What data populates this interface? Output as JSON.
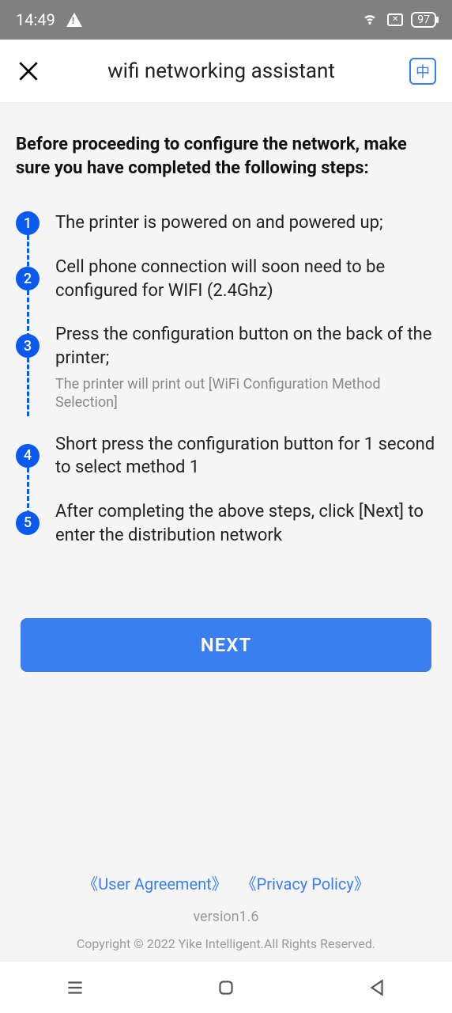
{
  "status": {
    "time": "14:49",
    "battery": "97"
  },
  "header": {
    "title": "wifi networking assistant",
    "lang": "中"
  },
  "intro": "Before proceeding to configure the network, make sure you have completed the following steps:",
  "steps": [
    {
      "num": "1",
      "text": "The printer is powered on and powered up;",
      "sub": ""
    },
    {
      "num": "2",
      "text": "Cell phone connection will soon need to be configured for WIFI (2.4Ghz)",
      "sub": ""
    },
    {
      "num": "3",
      "text": "Press the configuration button on the back of the printer;",
      "sub": "The printer will print out [WiFi Configuration Method Selection]"
    },
    {
      "num": "4",
      "text": "Short press the configuration button for 1 second to select method 1",
      "sub": ""
    },
    {
      "num": "5",
      "text": "After completing the above steps, click [Next] to enter the distribution network",
      "sub": ""
    }
  ],
  "next_label": "NEXT",
  "footer": {
    "user_agreement": "《User Agreement》",
    "privacy_policy": "《Privacy Policy》",
    "version": "version1.6",
    "copyright": "Copyright © 2022 Yike Intelligent.All Rights Reserved."
  }
}
